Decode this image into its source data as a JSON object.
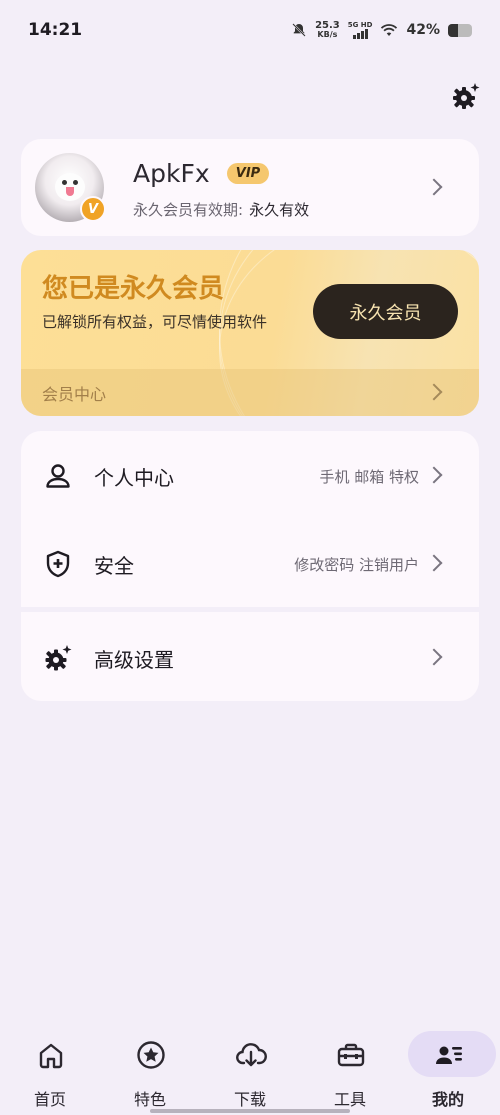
{
  "status_bar": {
    "time": "14:21",
    "net_speed_value": "25.3",
    "net_speed_unit": "KB/s",
    "signal_label": "5G HD",
    "battery_percent": "42%"
  },
  "profile": {
    "username": "ApkFx",
    "vip_label": "VIP",
    "badge_letter": "V",
    "expiry_label": "永久会员有效期:",
    "expiry_value": "永久有效"
  },
  "membership": {
    "title": "您已是永久会员",
    "subtitle": "已解锁所有权益，可尽情使用软件",
    "button_label": "永久会员",
    "footer_label": "会员中心"
  },
  "menu": {
    "items": [
      {
        "label": "个人中心",
        "hint": "手机 邮箱 特权",
        "icon": "person-icon"
      },
      {
        "label": "安全",
        "hint": "修改密码  注销用户",
        "icon": "shield-plus-icon"
      },
      {
        "label": "高级设置",
        "hint": "",
        "icon": "gear-sparkle-icon"
      }
    ]
  },
  "bottom_nav": {
    "items": [
      {
        "label": "首页",
        "icon": "home-icon"
      },
      {
        "label": "特色",
        "icon": "star-circle-icon"
      },
      {
        "label": "下载",
        "icon": "cloud-download-icon"
      },
      {
        "label": "工具",
        "icon": "toolbox-icon"
      },
      {
        "label": "我的",
        "icon": "profile-list-icon",
        "active": true
      }
    ]
  },
  "colors": {
    "background": "#f3eef8",
    "card": "#fdf8fd",
    "gold_title": "#d08a20",
    "member_button": "#2b241e",
    "nav_active_pill": "#e4dcf5"
  }
}
